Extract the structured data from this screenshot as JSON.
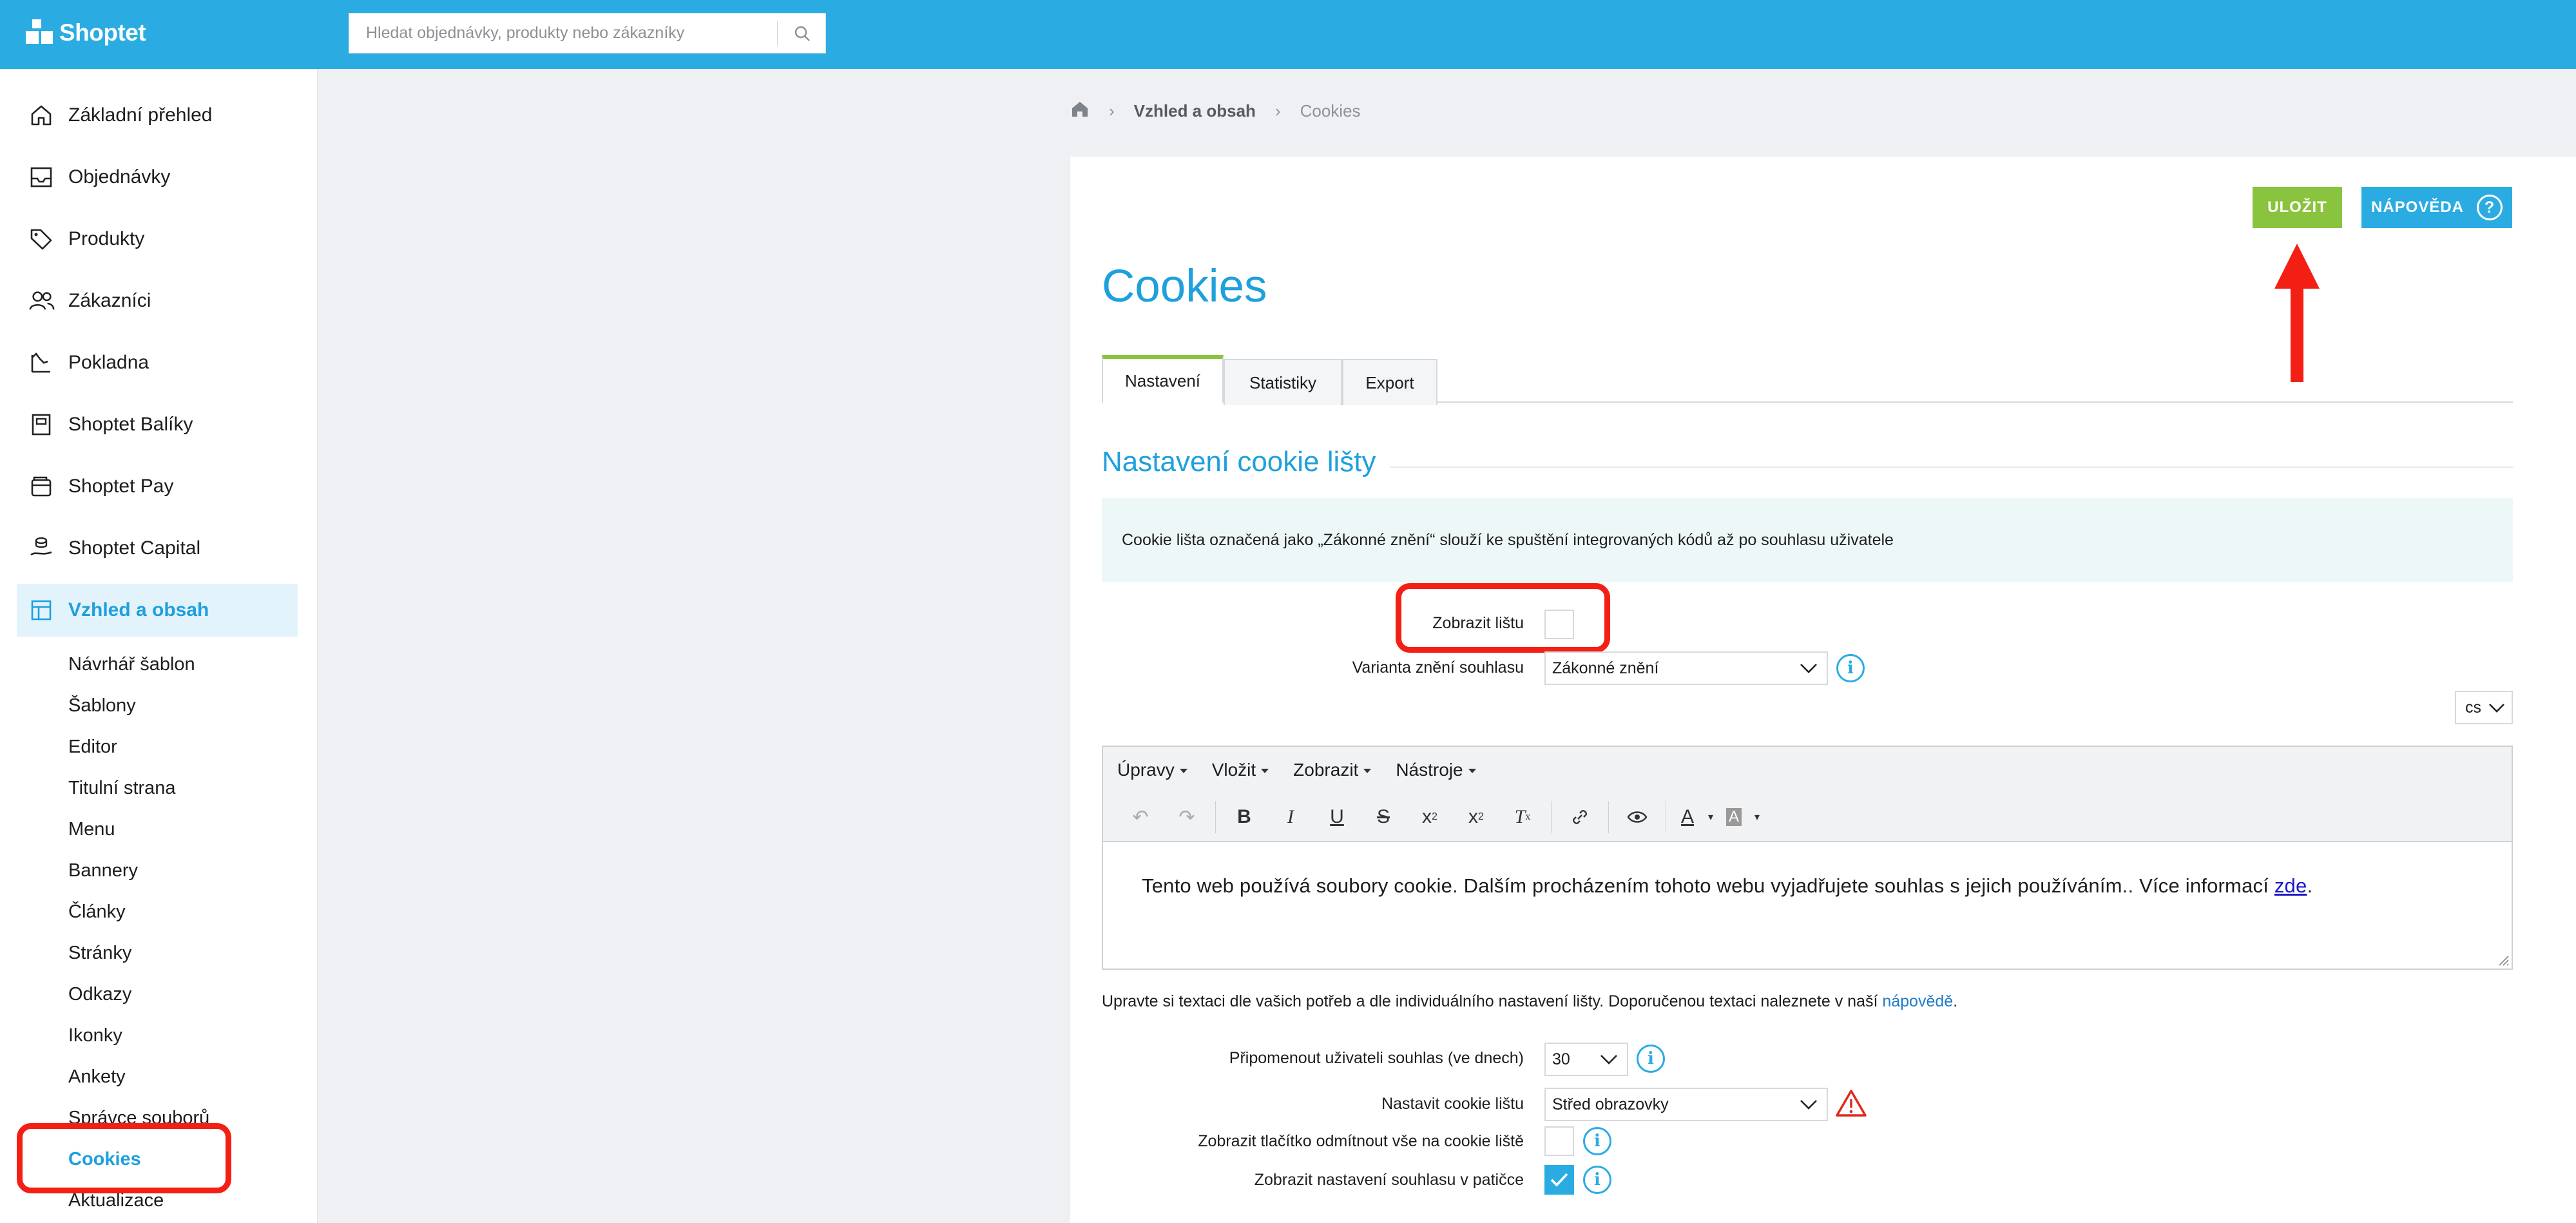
{
  "app": {
    "brand": "Shoptet"
  },
  "search": {
    "placeholder": "Hledat objednávky, produkty nebo zákazníky"
  },
  "sidebar": {
    "items": [
      {
        "label": "Základní přehled",
        "icon": "home-icon"
      },
      {
        "label": "Objednávky",
        "icon": "inbox-icon"
      },
      {
        "label": "Produkty",
        "icon": "tag-icon"
      },
      {
        "label": "Zákazníci",
        "icon": "users-icon"
      },
      {
        "label": "Pokladna",
        "icon": "register-icon"
      },
      {
        "label": "Shoptet Balíky",
        "icon": "package-icon"
      },
      {
        "label": "Shoptet Pay",
        "icon": "wallet-icon"
      },
      {
        "label": "Shoptet Capital",
        "icon": "capital-icon"
      },
      {
        "label": "Vzhled a obsah",
        "icon": "layout-icon",
        "active": true
      }
    ],
    "subitems": [
      "Návrhář šablon",
      "Šablony",
      "Editor",
      "Titulní strana",
      "Menu",
      "Bannery",
      "Články",
      "Stránky",
      "Odkazy",
      "Ikonky",
      "Ankety",
      "Správce souborů",
      "Cookies",
      "Aktualizace"
    ],
    "active_subitem": "Cookies"
  },
  "breadcrumb": {
    "section": "Vzhled a obsah",
    "current": "Cookies"
  },
  "actions": {
    "save": "ULOŽIT",
    "help": "NÁPOVĚDA"
  },
  "page": {
    "title": "Cookies"
  },
  "tabs": [
    "Nastavení",
    "Statistiky",
    "Export"
  ],
  "settings": {
    "section_title": "Nastavení cookie lišty",
    "info": "Cookie lišta označená jako „Zákonné znění“ slouží ke spuštění integrovaných kódů až po souhlasu uživatele",
    "show_bar_label": "Zobrazit lištu",
    "show_bar_checked": false,
    "variant_label": "Varianta znění souhlasu",
    "variant_value": "Zákonné znění",
    "language": "cs"
  },
  "editor": {
    "menus": [
      "Úpravy",
      "Vložit",
      "Zobrazit",
      "Nástroje"
    ],
    "content_text": "Tento web používá soubory cookie. Dalším procházením tohoto webu vyjadřujete souhlas s jejich používáním.. Více informací ",
    "content_link": "zde",
    "content_end": "."
  },
  "hint": {
    "text": "Upravte si textaci dle vašich potřeb a dle individuálního nastavení lišty. Doporučenou textaci naleznete v naší ",
    "link": "nápovědě",
    "end": "."
  },
  "more_settings": {
    "remind_label": "Připomenout uživateli souhlas (ve dnech)",
    "remind_value": "30",
    "position_label": "Nastavit cookie lištu",
    "position_value": "Střed obrazovky",
    "reject_label": "Zobrazit tlačítko odmítnout vše na cookie liště",
    "reject_checked": false,
    "footer_label": "Zobrazit nastavení souhlasu v patičce",
    "footer_checked": true
  },
  "colors": {
    "primary": "#2aace3",
    "save": "#8ac43f",
    "annotation": "#f41f14",
    "warning": "#e0281f"
  }
}
